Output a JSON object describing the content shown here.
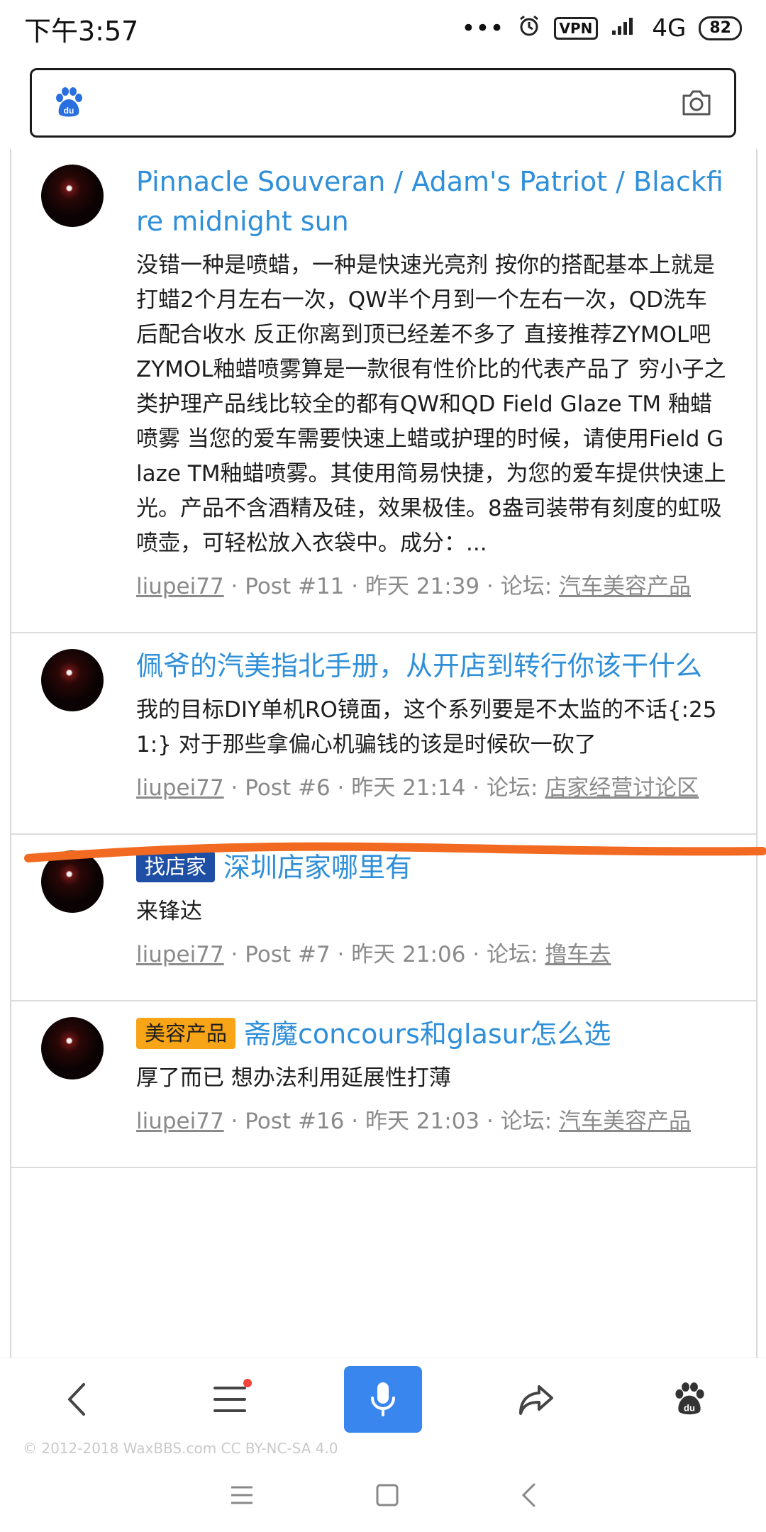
{
  "status_bar": {
    "time": "下午3:57",
    "dots": "•••",
    "vpn": "VPN",
    "network": "4G",
    "battery": "82"
  },
  "posts": [
    {
      "title": "Pinnacle Souveran / Adam's Patriot / Blackfire midnight sun",
      "body": "没错一种是喷蜡，一种是快速光亮剂 按你的搭配基本上就是打蜡2个月左右一次，QW半个月到一个左右一次，QD洗车后配合收水 反正你离到顶已经差不多了 直接推荐ZYMOL吧 ZYMOL釉蜡喷雾算是一款很有性价比的代表产品了 穷小子之类护理产品线比较全的都有QW和QD Field Glaze TM 釉蜡喷雾 当您的爱车需要快速上蜡或护理的时候，请使用Field Glaze TM釉蜡喷雾。其使用简易快捷，为您的爱车提供快速上光。产品不含酒精及硅，效果极佳。8盎司装带有刻度的虹吸喷壶，可轻松放入衣袋中。成分：...",
      "author": "liupei77",
      "post_no": "Post #11",
      "time": "昨天 21:39",
      "forum_label": "论坛:",
      "forum": "汽车美容产品"
    },
    {
      "title": "佩爷的汽美指北手册，从开店到转行你该干什么",
      "body": "我的目标DIY单机RO镜面，这个系列要是不太监的不话{:251:} 对于那些拿偏心机骗钱的该是时候砍一砍了",
      "author": "liupei77",
      "post_no": "Post #6",
      "time": "昨天 21:14",
      "forum_label": "论坛:",
      "forum": "店家经营讨论区"
    },
    {
      "tag": "找店家",
      "title": "深圳店家哪里有",
      "body": "来锋达",
      "author": "liupei77",
      "post_no": "Post #7",
      "time": "昨天 21:06",
      "forum_label": "论坛:",
      "forum": "撸车去"
    },
    {
      "tag": "美容产品",
      "title": "斋魔concours和glasur怎么选",
      "body": "厚了而已 想办法利用延展性打薄",
      "author": "liupei77",
      "post_no": "Post #16",
      "time": "昨天 21:03",
      "forum_label": "论坛:",
      "forum": "汽车美容产品"
    }
  ],
  "footer": "© 2012-2018 WaxBBS.com CC BY-NC-SA 4.0",
  "colors": {
    "link": "#2f8fd8",
    "mic": "#3a86ef",
    "tag_blue": "#1e4fa5",
    "tag_orange": "#f7a416",
    "annotation": "#f26a21"
  }
}
